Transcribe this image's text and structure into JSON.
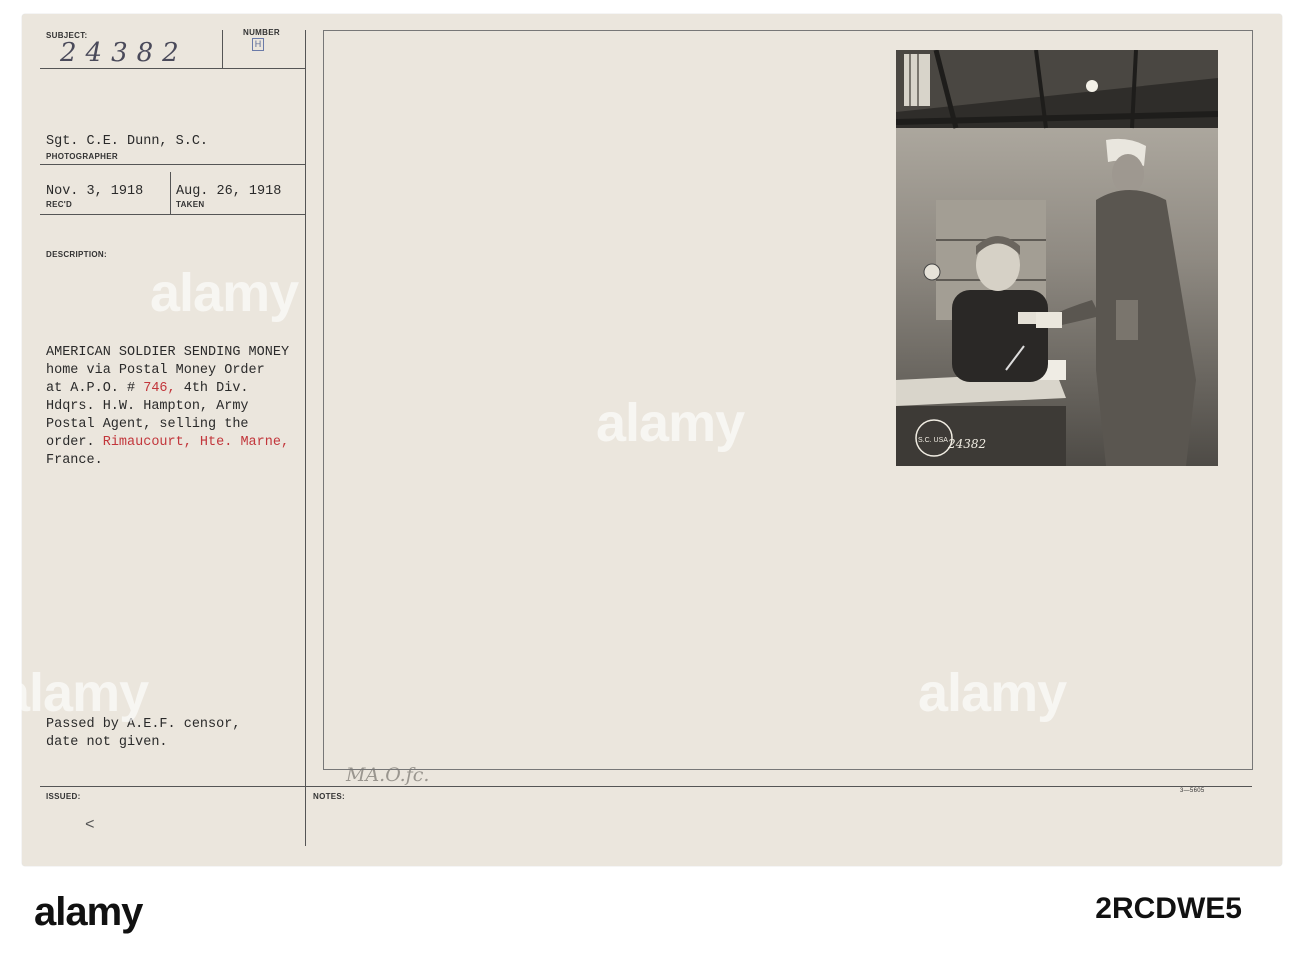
{
  "card": {
    "subject_label": "SUBJECT:",
    "number_label": "NUMBER",
    "subject_number": "24382",
    "number_mark": "H",
    "photographer": "Sgt. C.E. Dunn, S.C.",
    "photographer_label": "PHOTOGRAPHER",
    "received_date": "Nov. 3, 1918",
    "received_label": "REC'D",
    "taken_date": "Aug. 26, 1918",
    "taken_label": "TAKEN",
    "description_label": "DESCRIPTION:",
    "description": {
      "line1": "AMERICAN SOLDIER SENDING MONEY",
      "line2": "home via Postal Money Order",
      "line3_a": "at A.P.O. # ",
      "line3_red": "746,",
      "line3_b": " 4th Div.",
      "line4": "Hdqrs. H.W. Hampton, Army",
      "line5": "Postal Agent, selling the",
      "line6_a": "order. ",
      "line6_red": "Rimaucourt, Hte. Marne,",
      "line7": "France."
    },
    "censor_line1": "Passed by A.E.F. censor,",
    "censor_line2": "date not given.",
    "issued_label": "ISSUED:",
    "notes_label": "NOTES:",
    "notes_handwriting": "MA.O.fc.",
    "arrow_mark": "<",
    "form_code": "3—5605",
    "photo_stamp": "SIGNAL CORPS U.S.A.",
    "photo_number": "24382"
  },
  "watermark": {
    "text": "alamy"
  },
  "footer": {
    "logo": "alamy",
    "image_id": "2RCDWE5"
  }
}
